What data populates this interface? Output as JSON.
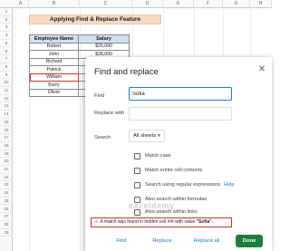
{
  "sheet": {
    "columns": [
      "A",
      "B",
      "C",
      "D",
      "E",
      "F",
      "G",
      "H"
    ],
    "rows": [
      "1",
      "2",
      "3",
      "4",
      "5",
      "6",
      "7",
      "8",
      "9",
      "10",
      "11",
      "12",
      "13",
      "14",
      "15",
      "16",
      "17",
      "18",
      "19",
      "20",
      "21",
      "22",
      "23",
      "24",
      "25",
      "26",
      "27",
      "28",
      "29"
    ],
    "title": "Applying Find & Replace Feature",
    "table": {
      "headers": [
        "Employee Name",
        "Salary"
      ],
      "rows": [
        [
          "Robert",
          "$25,000"
        ],
        [
          "John",
          "$28,000"
        ],
        [
          "Richard",
          ""
        ],
        [
          "Patrick",
          ""
        ],
        [
          "William",
          ""
        ],
        [
          "Barry",
          ""
        ],
        [
          "Oliver",
          ""
        ]
      ]
    }
  },
  "dialog": {
    "title": "Find and replace",
    "close_icon": "close-icon",
    "find_label": "Find",
    "find_value": "Sofia",
    "replace_label": "Replace with",
    "search_label": "Search",
    "search_value": "All sheets",
    "options": [
      {
        "label": "Match case",
        "checked": false
      },
      {
        "label": "Match entire cell contents",
        "checked": false
      },
      {
        "label": "Search using regular expressions",
        "help": "Help",
        "checked": false
      },
      {
        "label": "Also search within formulas",
        "checked": false
      },
      {
        "label": "Also search within links",
        "checked": false
      }
    ],
    "alert": {
      "icon": "warning-icon",
      "text_prefix": "A match was found in hidden cell ##f with value",
      "text_value": "\"Sofia\"."
    },
    "buttons": {
      "find": "Find",
      "replace": "Replace",
      "replace_all": "Replace all",
      "done": "Done"
    }
  },
  "watermark": {
    "text": "exceldemy",
    "sub": "EXCEL · DATA · BI"
  },
  "colors": {
    "accent": "#1a73e8",
    "done_button": "#188038",
    "alert_border": "#d93025",
    "title_fill": "#f9dcbf",
    "header_fill": "#cfe0f5"
  }
}
